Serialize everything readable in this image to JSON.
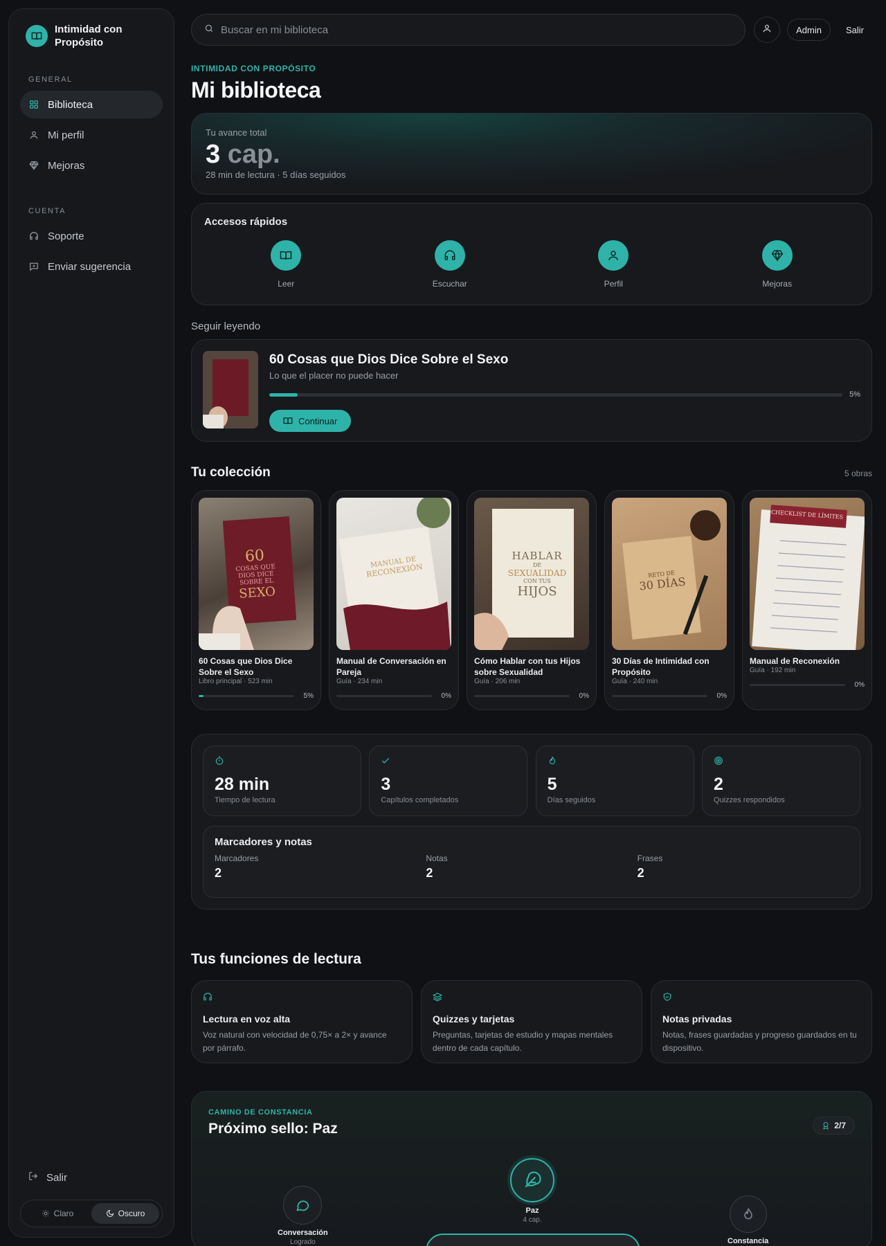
{
  "brand": {
    "name": "Intimidad con Propósito",
    "icon": "book-open-icon",
    "accent": "#2fb3a9"
  },
  "sidebar": {
    "sections": [
      {
        "label": "GENERAL",
        "items": [
          {
            "label": "Biblioteca",
            "icon": "grid-icon",
            "active": true
          },
          {
            "label": "Mi perfil",
            "icon": "user-icon"
          },
          {
            "label": "Mejoras",
            "icon": "diamond-icon"
          }
        ]
      },
      {
        "label": "CUENTA",
        "items": [
          {
            "label": "Soporte",
            "icon": "headset-icon"
          },
          {
            "label": "Enviar sugerencia",
            "icon": "message-plus-icon"
          }
        ]
      }
    ],
    "logout": "Salir",
    "theme": {
      "light": "Claro",
      "dark": "Oscuro",
      "selected": "Oscuro"
    }
  },
  "topbar": {
    "search_placeholder": "Buscar en mi biblioteca",
    "admin": "Admin",
    "logout": "Salir"
  },
  "header": {
    "eyebrow": "INTIMIDAD CON PROPÓSITO",
    "title": "Mi biblioteca"
  },
  "progress": {
    "label": "Tu avance total",
    "value": "3",
    "unit": "cap.",
    "sub": "28 min de lectura · 5 días seguidos"
  },
  "quick": {
    "title": "Accesos rápidos",
    "items": [
      {
        "label": "Leer",
        "icon": "book-icon"
      },
      {
        "label": "Escuchar",
        "icon": "headphones-icon"
      },
      {
        "label": "Perfil",
        "icon": "user-icon"
      },
      {
        "label": "Mejoras",
        "icon": "diamond-icon"
      }
    ]
  },
  "continue": {
    "heading": "Seguir leyendo",
    "title": "60 Cosas que Dios Dice Sobre el Sexo",
    "subtitle": "Lo que el placer no puede hacer",
    "progress": 5,
    "progress_label": "5%",
    "button": "Continuar"
  },
  "collection": {
    "title": "Tu colección",
    "count": "5 obras",
    "books": [
      {
        "title": "60 Cosas que Dios Dice Sobre el Sexo",
        "meta": "Libro principal · 523 min",
        "progress": 5,
        "pct": "5%",
        "cover": {
          "num": "60",
          "l1": "COSAS QUE",
          "l2": "DIOS DICE",
          "l3": "SOBRE EL",
          "big": "SEXO"
        }
      },
      {
        "title": "Manual de Conversación en Pareja",
        "meta": "Guía · 234 min",
        "progress": 0,
        "pct": "0%",
        "cover": {
          "l1": "MANUAL DE",
          "l2": "RECONEXIÓN"
        }
      },
      {
        "title": "Cómo Hablar con tus Hijos sobre Sexualidad",
        "meta": "Guía · 206 min",
        "progress": 0,
        "pct": "0%",
        "cover": {
          "l1": "HABLAR",
          "l2": "DE",
          "l3": "SEXUALIDAD",
          "l4": "CON TUS",
          "big": "HIJOS"
        }
      },
      {
        "title": "30 Días de Intimidad con Propósito",
        "meta": "Guía · 240 min",
        "progress": 0,
        "pct": "0%",
        "cover": {
          "l1": "RETO DE",
          "big": "30 DÍAS"
        }
      },
      {
        "title": "Manual de Reconexión",
        "meta": "Guía · 192 min",
        "progress": 0,
        "pct": "0%",
        "cover": {
          "l1": "CHECKLIST DE LÍMITES"
        }
      }
    ]
  },
  "stats": [
    {
      "value": "28 min",
      "label": "Tiempo de lectura",
      "icon": "timer-icon"
    },
    {
      "value": "3",
      "label": "Capítulos completados",
      "icon": "check-icon"
    },
    {
      "value": "5",
      "label": "Días seguidos",
      "icon": "flame-icon"
    },
    {
      "value": "2",
      "label": "Quizzes respondidos",
      "icon": "target-icon"
    }
  ],
  "notes": {
    "title": "Marcadores y notas",
    "items": [
      {
        "label": "Marcadores",
        "value": "2"
      },
      {
        "label": "Notas",
        "value": "2"
      },
      {
        "label": "Frases",
        "value": "2"
      }
    ]
  },
  "features": {
    "title": "Tus funciones de lectura",
    "items": [
      {
        "title": "Lectura en voz alta",
        "desc": "Voz natural con velocidad de 0,75× a 2× y avance por párrafo.",
        "icon": "headphones-icon"
      },
      {
        "title": "Quizzes y tarjetas",
        "desc": "Preguntas, tarjetas de estudio y mapas mentales dentro de cada capítulo.",
        "icon": "layers-icon"
      },
      {
        "title": "Notas privadas",
        "desc": "Notas, frases guardadas y progreso guardados en tu dispositivo.",
        "icon": "shield-check-icon"
      }
    ]
  },
  "path": {
    "eyebrow": "CAMINO DE CONSTANCIA",
    "title": "Próximo sello: Paz",
    "badge": "2/7",
    "nodes": [
      {
        "name": "Conversación",
        "sub": "Logrado",
        "icon": "chat-icon"
      },
      {
        "name": "Paz",
        "sub": "4 cap.",
        "icon": "feather-icon"
      },
      {
        "name": "Constancia",
        "sub": "",
        "icon": "flame-icon"
      }
    ]
  }
}
